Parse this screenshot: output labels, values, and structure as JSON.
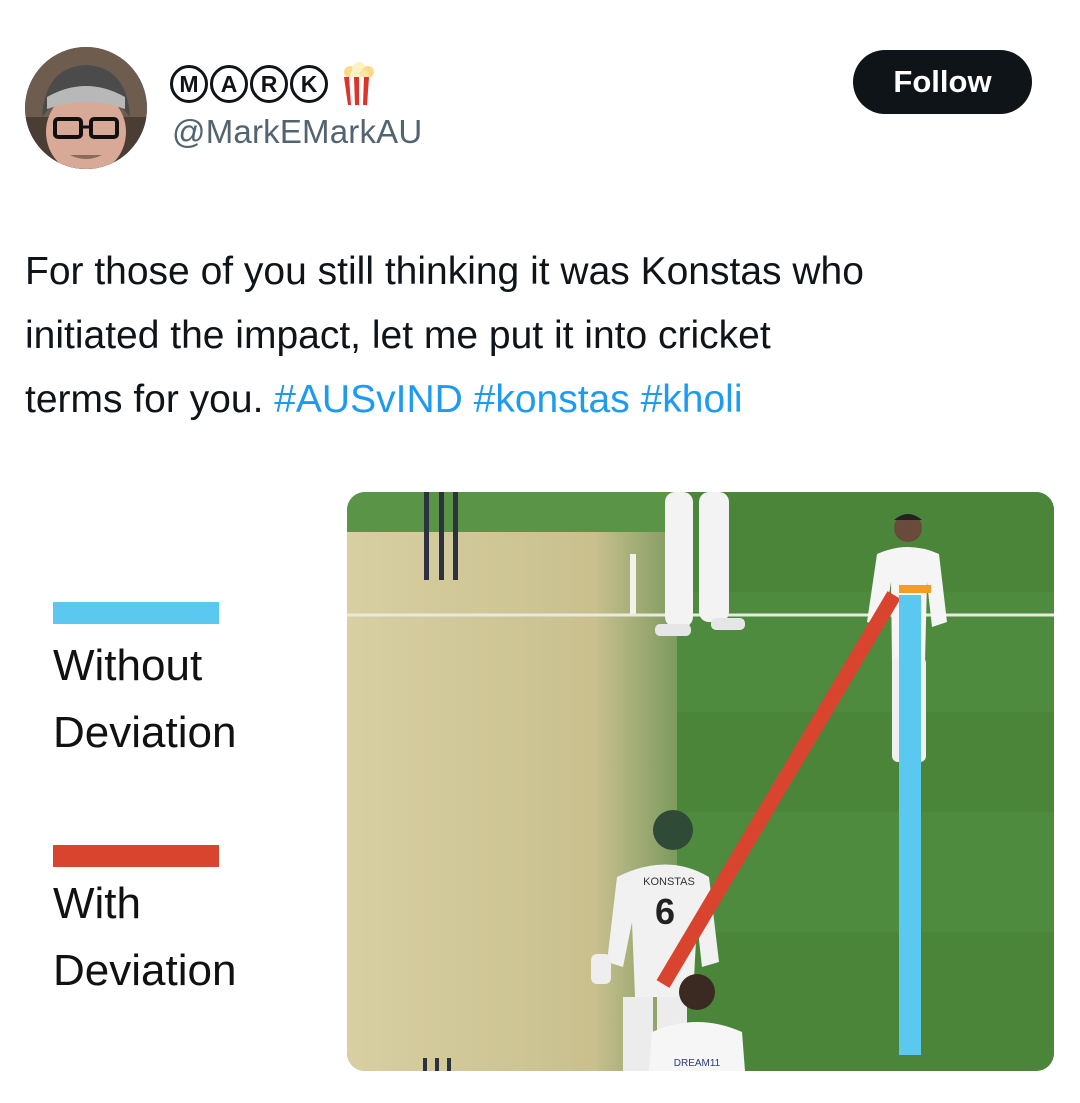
{
  "author": {
    "display_name_letters": [
      "M",
      "A",
      "R",
      "K"
    ],
    "display_name_emoji": "popcorn-emoji",
    "handle": "@MarkEMarkAU",
    "avatar_icon": "avatar-photo"
  },
  "follow_label": "Follow",
  "tweet": {
    "line1": "For those of you still thinking it was Konstas who",
    "line2": "initiated the impact, let me put it into cricket",
    "line3_plain": "terms for you. ",
    "hashtags": [
      "#AUSvIND",
      "#konstas",
      "#kholi"
    ]
  },
  "legend": {
    "without_line1": "Without",
    "without_line2": "Deviation",
    "with_line1": "With",
    "with_line2": "Deviation",
    "colors": {
      "without": "#5bc8f0",
      "with": "#d9442e"
    }
  },
  "media": {
    "player_name": "KONSTAS",
    "player_number": "6",
    "sponsor_text": "DREAM11"
  }
}
